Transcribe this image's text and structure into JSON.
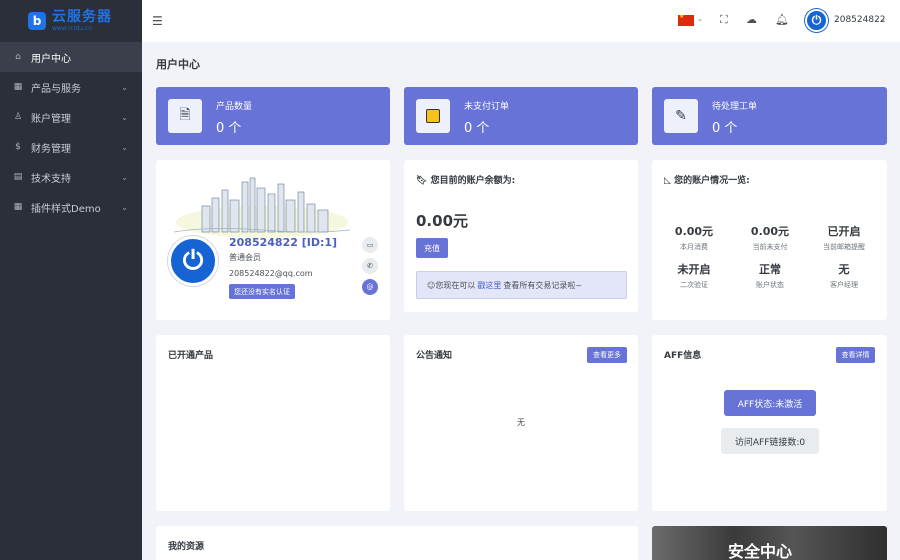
{
  "brand": {
    "logo_letter": "b",
    "name": "云服务器",
    "sub": "www.rcidu.cn"
  },
  "sidebar": {
    "items": [
      {
        "label": "用户中心",
        "icon": "home-icon"
      },
      {
        "label": "产品与服务",
        "icon": "grid-icon"
      },
      {
        "label": "账户管理",
        "icon": "user-icon"
      },
      {
        "label": "财务管理",
        "icon": "dollar-icon"
      },
      {
        "label": "技术支持",
        "icon": "ticket-icon"
      },
      {
        "label": "插件样式Demo",
        "icon": "grid-icon"
      }
    ]
  },
  "topbar": {
    "username": "208524822"
  },
  "page": {
    "title": "用户中心"
  },
  "stats": [
    {
      "label": "产品数量",
      "value": "0 个"
    },
    {
      "label": "未支付订单",
      "value": "0 个"
    },
    {
      "label": "待处理工单",
      "value": "0 个"
    }
  ],
  "profile": {
    "name": "208524822 [ID:1]",
    "level": "普通会员",
    "email": "208524822@qq.com",
    "badge": "您还没有实名认证"
  },
  "balance": {
    "title": "您目前的账户余额为:",
    "value": "0.00元",
    "recharge": "充值",
    "notice_prefix": "您现在可以",
    "notice_link": "戳这里",
    "notice_suffix": "查看所有交易记录啦~"
  },
  "overview": {
    "title": "您的账户情况一览:",
    "items": [
      {
        "value": "0.00元",
        "label": "本月消费"
      },
      {
        "value": "0.00元",
        "label": "当前未支付"
      },
      {
        "value": "已开启",
        "label": "当前邮箱提醒"
      },
      {
        "value": "未开启",
        "label": "二次验证"
      },
      {
        "value": "正常",
        "label": "账户状态"
      },
      {
        "value": "无",
        "label": "客户经理"
      }
    ]
  },
  "products": {
    "title": "已开通产品"
  },
  "announcements": {
    "title": "公告通知",
    "more": "查看更多",
    "empty": "无"
  },
  "aff": {
    "title": "AFF信息",
    "detail": "查看详情",
    "status": "AFF状态:未激活",
    "visits": "访问AFF链接数:0"
  },
  "resources": {
    "title": "我的资源"
  },
  "security": {
    "title": "安全中心"
  },
  "colors": {
    "primary": "#6773d6",
    "sidebar": "#2b2f3a",
    "brand": "#1e73e8"
  }
}
